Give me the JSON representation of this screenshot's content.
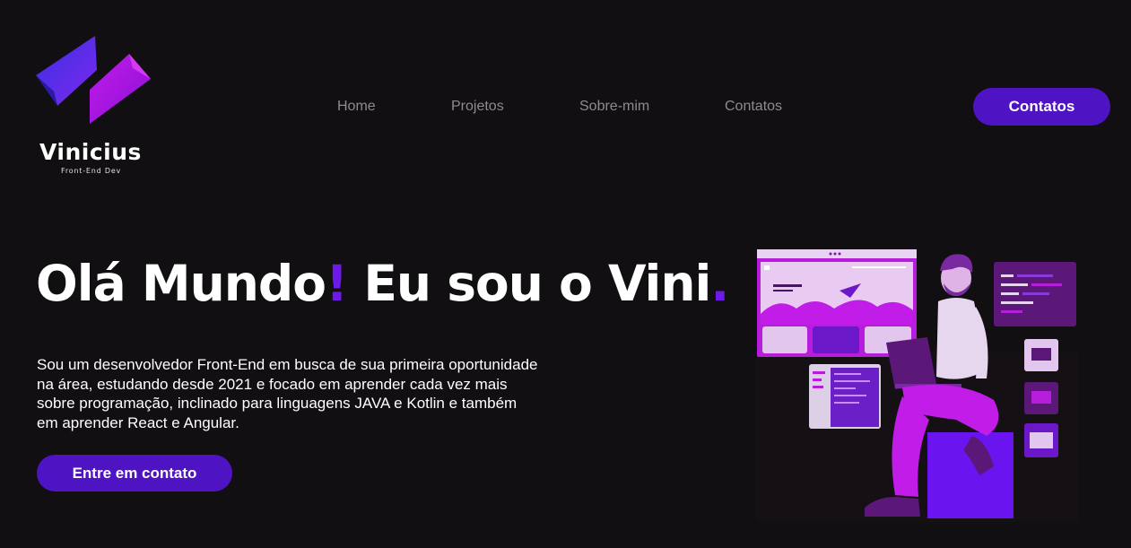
{
  "brand": {
    "name": "Vinicius",
    "subtitle": "Front-End Dev"
  },
  "nav": {
    "items": [
      {
        "label": "Home"
      },
      {
        "label": "Projetos"
      },
      {
        "label": "Sobre-mim"
      },
      {
        "label": "Contatos"
      }
    ],
    "cta_label": "Contatos"
  },
  "hero": {
    "title_part1": "Olá Mundo",
    "title_mark1": "!",
    "title_part2": " Eu sou o Vini",
    "title_mark2": ".",
    "description": "Sou um desenvolvedor Front-End em busca de sua primeira oportunidade na área, estudando desde 2021 e focado em aprender cada vez mais sobre programação, inclinado para linguagens JAVA e Kotlin e também em aprender React e Angular.",
    "cta_label": "Entre em contato"
  },
  "colors": {
    "background": "#110f11",
    "accent": "#6b1ae8",
    "button": "#4e13c2",
    "nav_text": "#8d8b8e",
    "illustration_magenta": "#a20fd8"
  },
  "illustration": {
    "icon": "developer-with-laptop-illustration"
  }
}
